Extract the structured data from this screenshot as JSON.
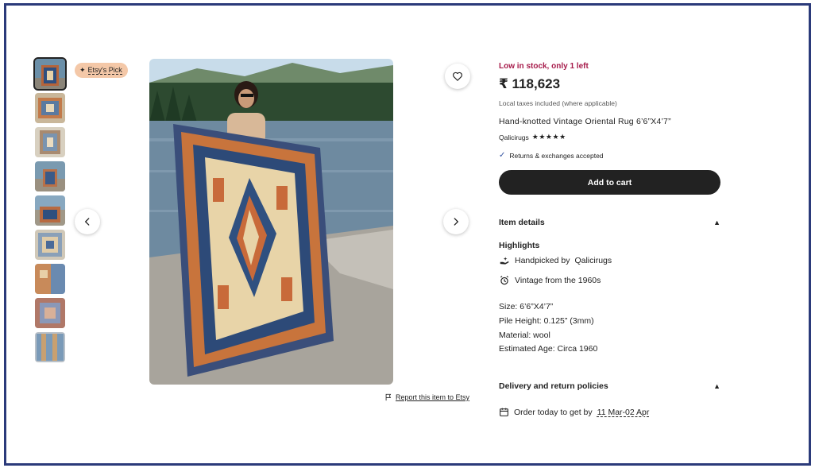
{
  "badge": {
    "label": "Etsy's Pick"
  },
  "report": {
    "label": "Report this item to Etsy"
  },
  "product": {
    "stock": "Low in stock, only 1 left",
    "price": "₹ 118,623",
    "tax_note": "Local taxes included (where applicable)",
    "title": "Hand-knotted Vintage Oriental Rug 6’6”X4’7”",
    "shop_name": "Qalicirugs",
    "rating_stars": "★★★★★",
    "returns": "Returns & exchanges accepted",
    "add_to_cart": "Add to cart"
  },
  "item_details": {
    "heading": "Item details",
    "highlights_title": "Highlights",
    "handpicked_prefix": "Handpicked by",
    "handpicked_shop": "Qalicirugs",
    "vintage": "Vintage from the 1960s",
    "specs": [
      "Size: 6’6”X4’7”",
      "Pile Height: 0.125” (3mm)",
      "Material: wool",
      "Estimated Age: Circa 1960"
    ]
  },
  "delivery": {
    "heading": "Delivery and return policies",
    "order_prefix": "Order today to get by",
    "date_range": "11 Mar-02 Apr"
  },
  "colors": {
    "stock_red": "#a61a4a",
    "badge_bg": "#f4c8a8",
    "button_dark": "#222222",
    "frame_border": "#2b3a7a"
  },
  "icons": [
    "sparkle-icon",
    "heart-icon",
    "chevron-left-icon",
    "chevron-right-icon",
    "flag-icon",
    "check-icon",
    "caret-up-icon",
    "hand-icon",
    "alarm-clock-icon",
    "calendar-icon"
  ],
  "thumbnail_count": 9
}
